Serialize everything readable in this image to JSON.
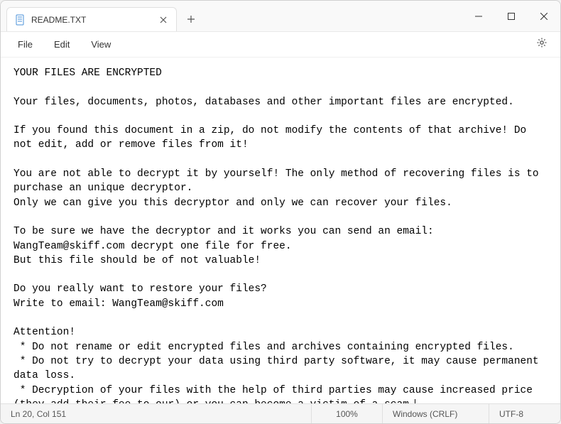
{
  "tab": {
    "title": "README.TXT"
  },
  "menu": {
    "file": "File",
    "edit": "Edit",
    "view": "View"
  },
  "content": {
    "text": "YOUR FILES ARE ENCRYPTED\n\nYour files, documents, photos, databases and other important files are encrypted.\n\nIf you found this document in a zip, do not modify the contents of that archive! Do not edit, add or remove files from it!\n\nYou are not able to decrypt it by yourself! The only method of recovering files is to purchase an unique decryptor.\nOnly we can give you this decryptor and only we can recover your files.\n\nTo be sure we have the decryptor and it works you can send an email: WangTeam@skiff.com decrypt one file for free.\nBut this file should be of not valuable!\n\nDo you really want to restore your files?\nWrite to email: WangTeam@skiff.com\n\nAttention!\n * Do not rename or edit encrypted files and archives containing encrypted files.\n * Do not try to decrypt your data using third party software, it may cause permanent data loss.\n * Decryption of your files with the help of third parties may cause increased price (they add their fee to our) or you can become a victim of a scam."
  },
  "status": {
    "position": "Ln 20, Col 151",
    "zoom": "100%",
    "line_ending": "Windows (CRLF)",
    "encoding": "UTF-8"
  }
}
